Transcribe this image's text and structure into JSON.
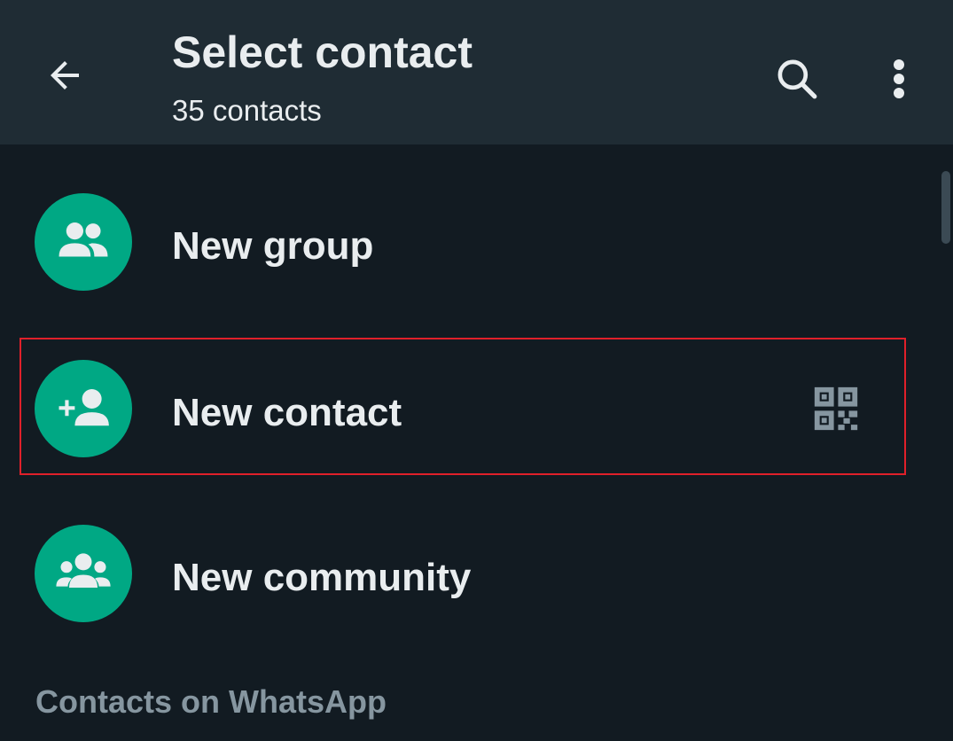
{
  "header": {
    "title": "Select contact",
    "subtitle": "35 contacts",
    "back_icon": "arrow-left-icon",
    "search_icon": "search-icon",
    "more_icon": "more-vert-icon"
  },
  "actions": [
    {
      "label": "New group",
      "icon": "group-icon"
    },
    {
      "label": "New contact",
      "icon": "person-add-icon",
      "trailing_icon": "qr-code-icon"
    },
    {
      "label": "New community",
      "icon": "community-icon"
    }
  ],
  "section": {
    "title": "Contacts on WhatsApp"
  },
  "colors": {
    "background": "#121b22",
    "appbar": "#1f2c34",
    "accent": "#00a884",
    "text_primary": "#e9edef",
    "text_secondary": "#8696a0",
    "highlight_border": "#e0202a"
  }
}
